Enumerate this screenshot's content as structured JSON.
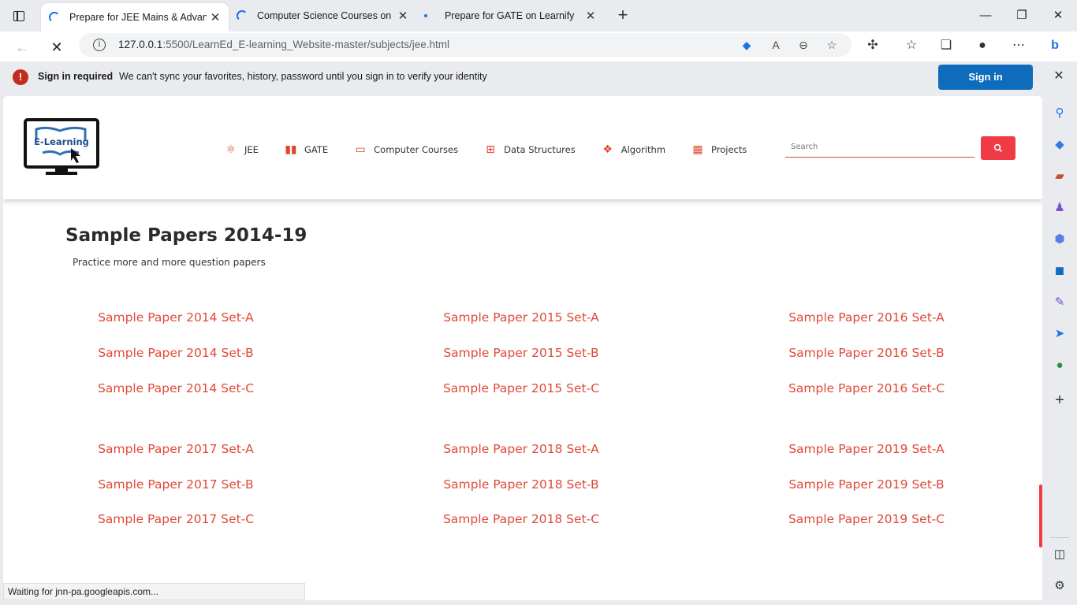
{
  "browser": {
    "tabs": [
      {
        "label": "Prepare for JEE Mains & Advanced",
        "active": true,
        "state": "loading"
      },
      {
        "label": "Computer Science Courses on Le",
        "active": false,
        "state": "loading"
      },
      {
        "label": "Prepare for GATE on Learnify",
        "active": false,
        "state": "idle"
      }
    ],
    "new_tab_label": "+",
    "address": {
      "host": "127.0.0.1",
      "rest": ":5500/LearnEd_E-learning_Website-master/subjects/jee.html"
    },
    "infobar": {
      "icon": "!",
      "title": "Sign in required",
      "message": "We can't sync your favorites, history, password until you sign in to verify your identity",
      "button": "Sign in"
    },
    "status_text": "Waiting for jnn-pa.googleapis.com..."
  },
  "site": {
    "logo_text": "E-Learning",
    "nav": [
      {
        "label": "JEE",
        "icon": "atom-icon"
      },
      {
        "label": "GATE",
        "icon": "book-icon"
      },
      {
        "label": "Computer Courses",
        "icon": "laptop-icon"
      },
      {
        "label": "Data Structures",
        "icon": "sitemap-icon"
      },
      {
        "label": "Algorithm",
        "icon": "cubes-icon"
      },
      {
        "label": "Projects",
        "icon": "project-board-icon"
      }
    ],
    "search_placeholder": "Search"
  },
  "main": {
    "title": "Sample Papers 2014-19",
    "subtitle": "Practice more and more question papers",
    "papers": [
      "Sample Paper 2014 Set-A",
      "Sample Paper 2015 Set-A",
      "Sample Paper 2016 Set-A",
      "Sample Paper 2014 Set-B",
      "Sample Paper 2015 Set-B",
      "Sample Paper 2016 Set-B",
      "Sample Paper 2014 Set-C",
      "Sample Paper 2015 Set-C",
      "Sample Paper 2016 Set-C",
      "Sample Paper 2017 Set-A",
      "Sample Paper 2018 Set-A",
      "Sample Paper 2019 Set-A",
      "Sample Paper 2017 Set-B",
      "Sample Paper 2018 Set-B",
      "Sample Paper 2019 Set-B",
      "Sample Paper 2017 Set-C",
      "Sample Paper 2018 Set-C",
      "Sample Paper 2019 Set-C"
    ]
  },
  "colors": {
    "accent": "#e04a3a",
    "search_button": "#ef3b45",
    "signin_button": "#0f6cbd"
  }
}
